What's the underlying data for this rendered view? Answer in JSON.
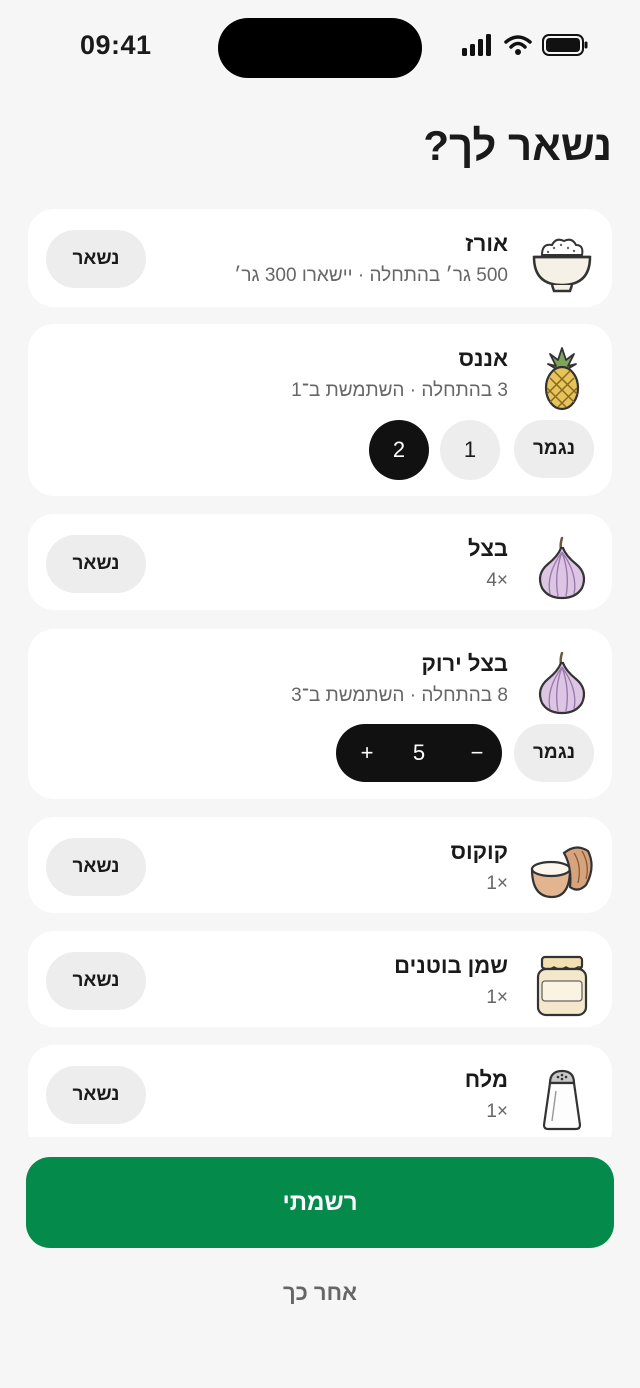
{
  "status_bar": {
    "time": "09:41"
  },
  "page": {
    "title": "נשאר לך?"
  },
  "items": [
    {
      "name": "אורז",
      "meta": "500 גר׳ בהתחלה · יישארו 300 גר׳",
      "action_label": "נשאר",
      "icon": "rice-bowl-icon"
    },
    {
      "name": "אננס",
      "meta": "3 בהתחלה · השתמשת ב־1",
      "done_label": "נגמר",
      "options": [
        "1",
        "2"
      ],
      "selected_option": "2",
      "icon": "pineapple-icon"
    },
    {
      "name": "בצל",
      "meta": "×4",
      "action_label": "נשאר",
      "icon": "onion-icon"
    },
    {
      "name": "בצל ירוק",
      "meta": "8 בהתחלה · השתמשת ב־3",
      "done_label": "נגמר",
      "stepper": {
        "minus": "−",
        "value": "5",
        "plus": "+"
      },
      "icon": "onion-icon"
    },
    {
      "name": "קוקוס",
      "meta": "×1",
      "action_label": "נשאר",
      "icon": "coconut-icon"
    },
    {
      "name": "שמן בוטנים",
      "meta": "×1",
      "action_label": "נשאר",
      "icon": "peanut-butter-jar-icon"
    },
    {
      "name": "מלח",
      "meta": "×1",
      "action_label": "נשאר",
      "icon": "salt-shaker-icon"
    }
  ],
  "footer": {
    "primary_label": "רשמתי",
    "secondary_label": "אחר כך"
  },
  "colors": {
    "accent": "#048a4a",
    "background": "#f6f6f6",
    "card": "#ffffff",
    "pill": "#ededed",
    "selected": "#111111"
  }
}
